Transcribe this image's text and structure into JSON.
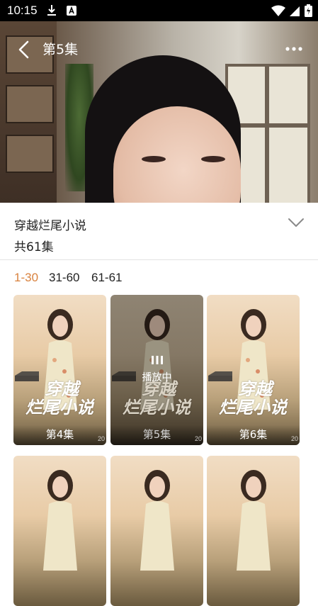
{
  "status_bar": {
    "time": "10:15"
  },
  "nav": {
    "title": "第5集"
  },
  "drama": {
    "title": "穿越烂尾小说",
    "episode_total": "共61集"
  },
  "range_tabs": [
    {
      "label": "1-30",
      "active": true
    },
    {
      "label": "31-60",
      "active": false
    },
    {
      "label": "61-61",
      "active": false
    }
  ],
  "cover_text": {
    "line1": "穿越",
    "line2": "烂尾小说",
    "corner": "20"
  },
  "episodes": [
    {
      "label": "第4集"
    },
    {
      "label": "第5集",
      "playing_label": "播放中"
    },
    {
      "label": "第6集"
    }
  ],
  "colors": {
    "accent": "#d9823e",
    "status_bar_bg": "#000000"
  }
}
